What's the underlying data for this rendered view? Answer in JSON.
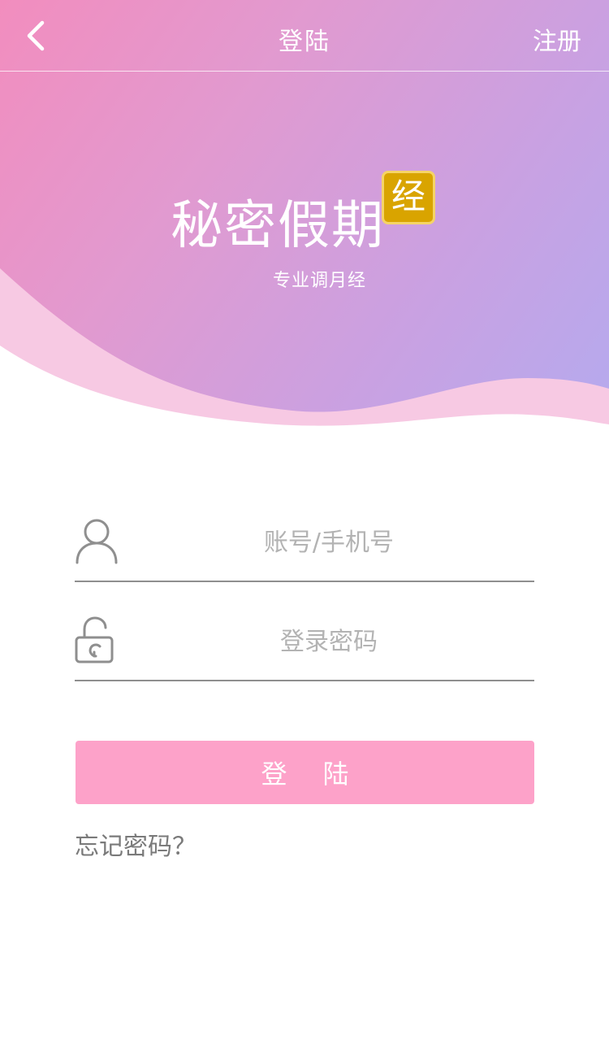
{
  "nav": {
    "title": "登陆",
    "register_label": "注册",
    "back_icon": "chevron-left-icon"
  },
  "brand": {
    "name": "秘密假期",
    "badge": "经",
    "slogan": "专业调月经",
    "colors": {
      "gradient_start": "#f28dbe",
      "gradient_end": "#b5aaee",
      "badge": "#d9a400"
    }
  },
  "form": {
    "account": {
      "placeholder": "账号/手机号",
      "value": "",
      "icon": "user-icon"
    },
    "password": {
      "placeholder": "登录密码",
      "value": "",
      "icon": "lock-icon"
    },
    "login_label": "登陆",
    "login_color": "#fda2c9",
    "forgot_label": "忘记密码？"
  }
}
